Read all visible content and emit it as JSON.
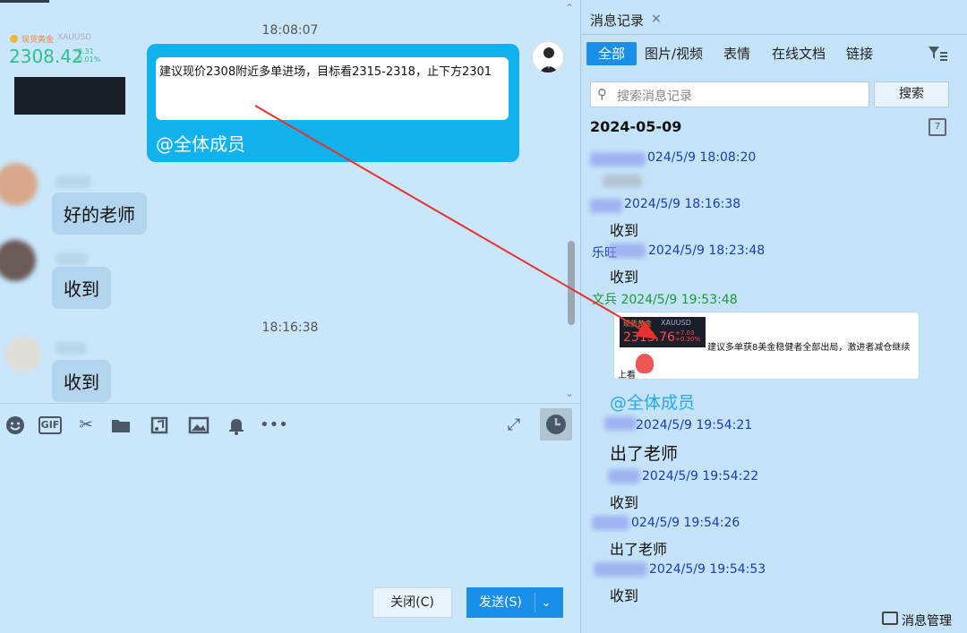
{
  "chat": {
    "timestamps": [
      "18:08:07",
      "18:16:38"
    ],
    "outgoing": {
      "text": "建议现价2308附近多单进场，目标看2315-2318，止下方2301",
      "mention": "@全体成员",
      "ticker": {
        "name": "现货黄金",
        "symbol": "XAUUSD",
        "price": "2308.42",
        "change": "-0.31",
        "change_pct": "-0.01%"
      }
    },
    "messages": [
      {
        "text": "好的老师"
      },
      {
        "text": "收到"
      },
      {
        "text": "收到"
      }
    ]
  },
  "toolbar": {
    "icons": [
      "emoji-icon",
      "gif-icon",
      "scissors-icon",
      "folder-icon",
      "music-icon",
      "image-icon",
      "bell-icon",
      "more-icon"
    ],
    "gif_label": "GIF"
  },
  "input": {
    "close_label": "关闭(C)",
    "send_label": "发送(S)"
  },
  "panel": {
    "tab_label": "消息记录",
    "filters": [
      "全部",
      "图片/视频",
      "表情",
      "在线文档",
      "链接"
    ],
    "search_placeholder": "搜索消息记录",
    "search_button": "搜索",
    "date": "2024-05-09",
    "calendar_label": "7",
    "records": [
      {
        "head": "024/5/9 18:08:20",
        "body": ""
      },
      {
        "head": "2024/5/9 18:16:38",
        "body": "收到"
      },
      {
        "head": "2024/5/9 18:23:48",
        "body": "收到"
      },
      {
        "head": "文兵 2024/5/9 19:53:48",
        "body": ""
      },
      {
        "head": "2024/5/9 19:54:21",
        "body": "出了老师"
      },
      {
        "head": "2024/5/9 19:54:22",
        "body": "收到"
      },
      {
        "head": "024/5/9 19:54:26",
        "body": "出了老师"
      },
      {
        "head": "2024/5/9 19:54:53",
        "body": "收到"
      }
    ],
    "partial_prefixes": [
      "乐旺",
      "上看"
    ],
    "image_card": {
      "ticker_name": "现货黄金",
      "ticker_symbol": "XAUUSD",
      "price": "2315.76",
      "change": "+7.03",
      "change_pct": "+0.30%",
      "desc": "建议多单获8美金稳健者全部出局，激进者减仓继续",
      "desc2": "上看"
    },
    "mention": "@全体成员",
    "manage_label": "消息管理"
  }
}
